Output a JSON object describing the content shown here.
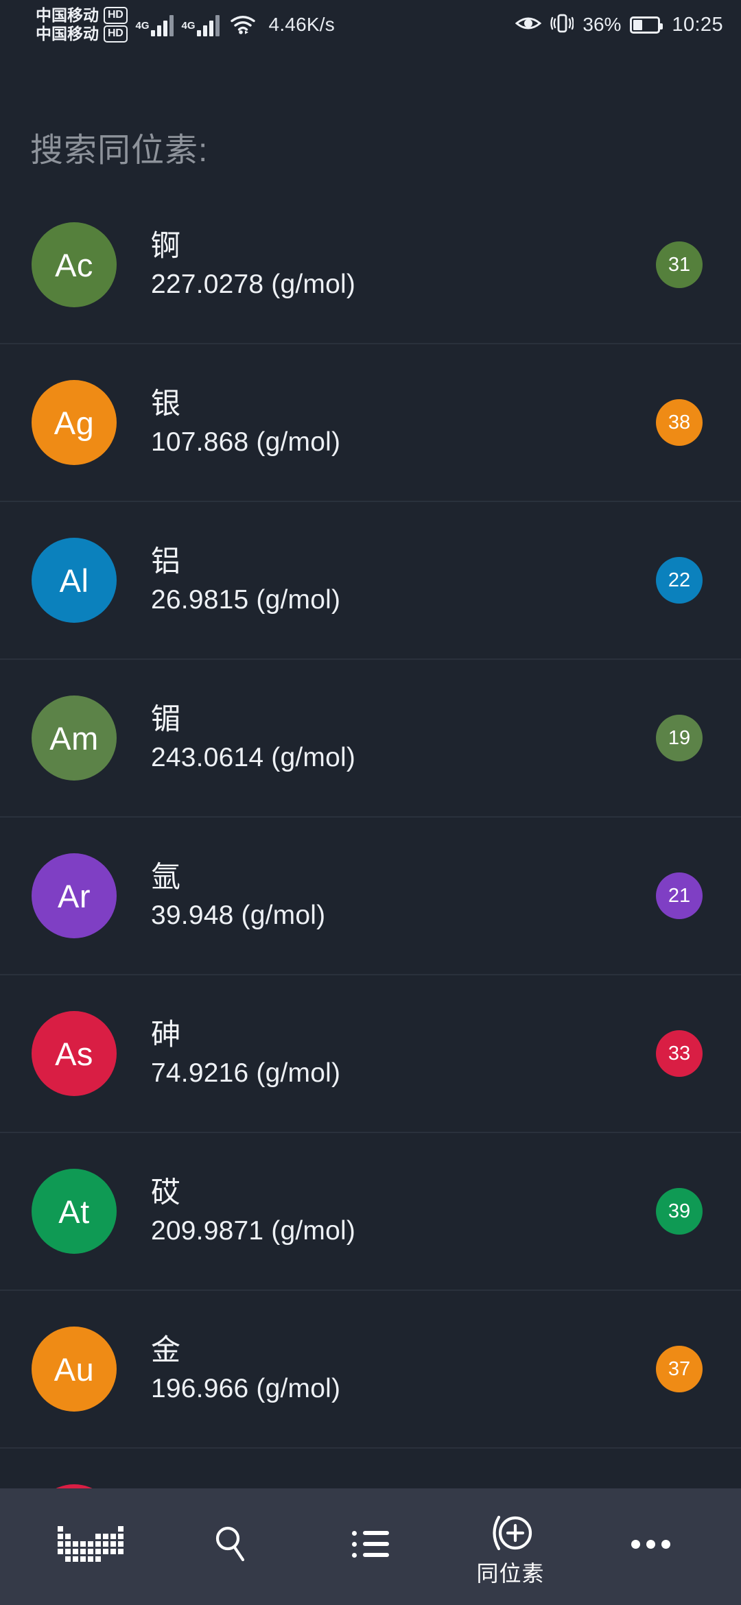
{
  "status_bar": {
    "carrier_line_1": "中国移动",
    "carrier_line_2": "中国移动",
    "hd_badge_1": "HD",
    "hd_badge_2": "HD",
    "network_type_1": "4G",
    "network_type_2": "4G",
    "wifi_icon": "wifi-icon",
    "network_speed": "4.46K/s",
    "eye_icon": "eye-comfort-icon",
    "vibrate_icon": "vibrate-icon",
    "battery_percent": "36%",
    "battery_icon": "battery-icon",
    "battery_level": 36,
    "clock": "10:25"
  },
  "search": {
    "placeholder": "搜索同位素:",
    "value": ""
  },
  "colors": {
    "page_background": "#1e242e",
    "nav_background": "#353a48",
    "divider": "#2a313c",
    "text_primary": "#f2f4f7",
    "text_muted": "#8e939b"
  },
  "list": {
    "mass_unit": "(g/mol)",
    "items": [
      {
        "symbol": "Ac",
        "name": "锕",
        "mass": "227.0278 (g/mol)",
        "count": "31",
        "color": "#55803c"
      },
      {
        "symbol": "Ag",
        "name": "银",
        "mass": "107.868 (g/mol)",
        "count": "38",
        "color": "#ef8b15"
      },
      {
        "symbol": "Al",
        "name": "铝",
        "mass": "26.9815 (g/mol)",
        "count": "22",
        "color": "#0b81bd"
      },
      {
        "symbol": "Am",
        "name": "镅",
        "mass": "243.0614 (g/mol)",
        "count": "19",
        "color": "#5c8348"
      },
      {
        "symbol": "Ar",
        "name": "氩",
        "mass": "39.948 (g/mol)",
        "count": "21",
        "color": "#7f3fc4"
      },
      {
        "symbol": "As",
        "name": "砷",
        "mass": "74.9216 (g/mol)",
        "count": "33",
        "color": "#d91e44"
      },
      {
        "symbol": "At",
        "name": "砹",
        "mass": "209.9871 (g/mol)",
        "count": "39",
        "color": "#0f9a54"
      },
      {
        "symbol": "Au",
        "name": "金",
        "mass": "196.966 (g/mol)",
        "count": "37",
        "color": "#ef8b15"
      },
      {
        "symbol": "",
        "name": "",
        "mass": "",
        "count": "",
        "color": "#d91e44"
      }
    ]
  },
  "bottom_nav": {
    "items": [
      {
        "icon": "periodic-table-icon",
        "label": "",
        "active": false
      },
      {
        "icon": "search-icon",
        "label": "",
        "active": false
      },
      {
        "icon": "list-icon",
        "label": "",
        "active": false
      },
      {
        "icon": "isotope-icon",
        "label": "同位素",
        "active": true
      },
      {
        "icon": "more-icon",
        "label": "",
        "active": false
      }
    ]
  }
}
